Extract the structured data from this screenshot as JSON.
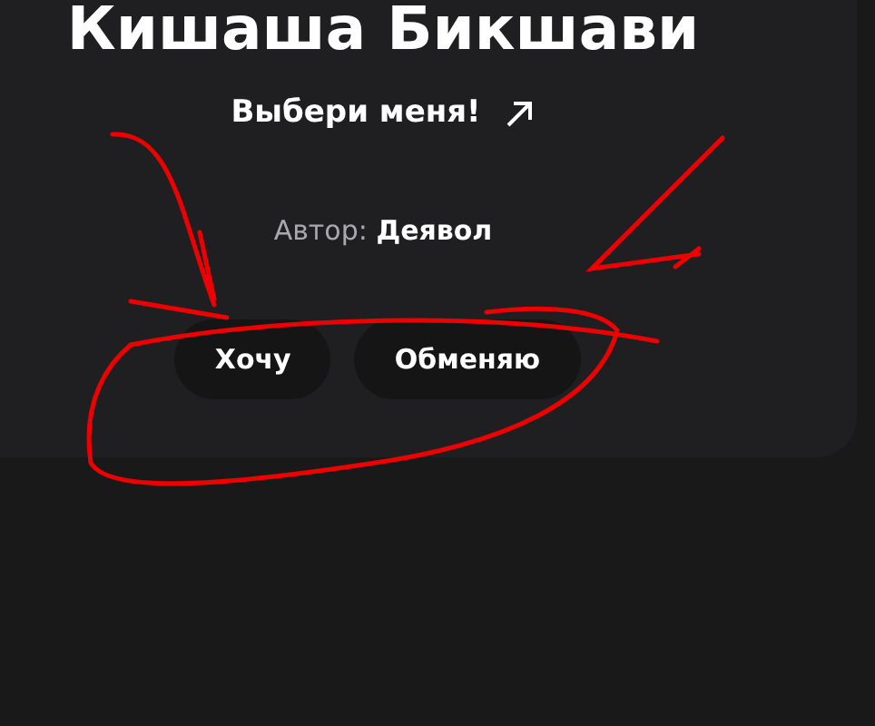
{
  "card": {
    "title": "Кишаша Бикшави",
    "link": "Выбери меня!",
    "author": "Автор: **Деявол**",
    "buttons": [
      "Хочу",
      "Обменяю"
    ]
  }
}
